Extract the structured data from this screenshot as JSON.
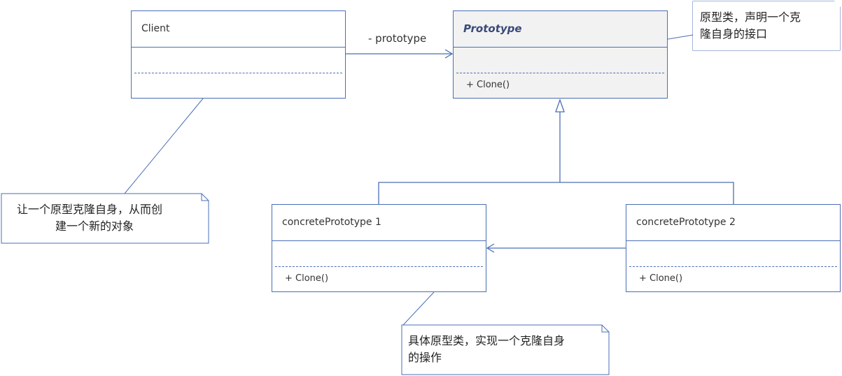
{
  "classes": {
    "client": {
      "name": "Client",
      "operation": ""
    },
    "prototype": {
      "name": "Prototype",
      "operation": "+ Clone()"
    },
    "concrete1": {
      "name": "concretePrototype 1",
      "operation": "+ Clone()"
    },
    "concrete2": {
      "name": "concretePrototype 2",
      "operation": "+ Clone()"
    }
  },
  "association_label": "- prototype",
  "notes": {
    "prototype_note": {
      "line1": "原型类，声明一个克",
      "line2": "隆自身的接口"
    },
    "client_note": {
      "line1": "让一个原型克隆自身，从而创",
      "line2": "建一个新的对象"
    },
    "concrete_note": {
      "line1": "具体原型类，实现一个克隆自身",
      "line2": "的操作"
    }
  },
  "colors": {
    "line": "#4a6fb5",
    "gray_fill": "#f2f2f2"
  }
}
